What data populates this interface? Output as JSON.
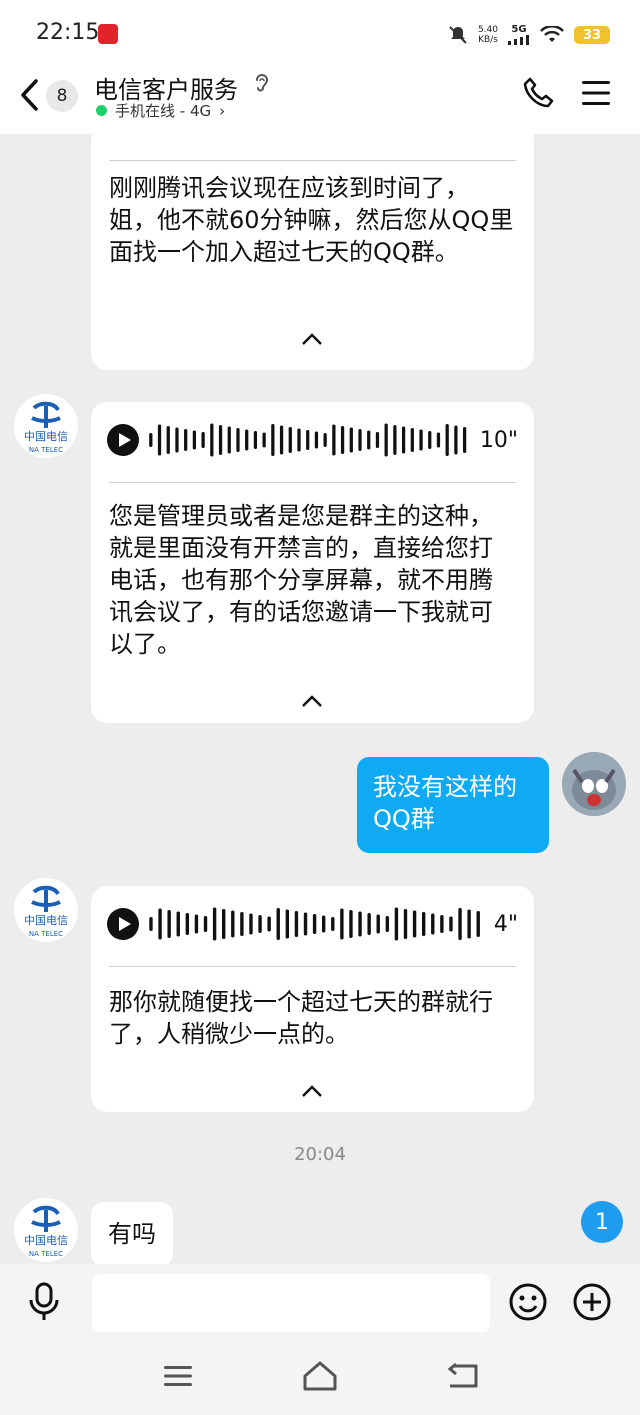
{
  "status_bar": {
    "time": "22:15",
    "net_speed_value": "5.40",
    "net_speed_unit": "KB/s",
    "network": "5G",
    "battery": "33"
  },
  "header": {
    "unread_count": "8",
    "title": "电信客户服务",
    "status": "手机在线 - 4G",
    "status_chevron": "›"
  },
  "messages": {
    "card1_text": "刚刚腾讯会议现在应该到时间了，姐，他不就60分钟嘛，然后您从QQ里面找一个加入超过七天的QQ群。",
    "card2_duration": "10\"",
    "card2_text": "您是管理员或者是您是群主的这种，就是里面没有开禁言的，直接给您打电话，也有那个分享屏幕，就不用腾讯会议了，有的话您邀请一下我就可以了。",
    "my_text": "我没有这样的QQ群",
    "card3_duration": "4\"",
    "card3_text": "那你就随便找一个超过七天的群就行了，人稍微少一点的。",
    "timestamp": "20:04",
    "last_text": "有吗"
  },
  "floating_unread": "1",
  "avatar_text": {
    "cn": "中国电信",
    "en": "NA TELEC"
  },
  "colors": {
    "accent": "#0fa9f4",
    "online": "#1fcf6b",
    "telecom_blue": "#1a5fb4"
  }
}
